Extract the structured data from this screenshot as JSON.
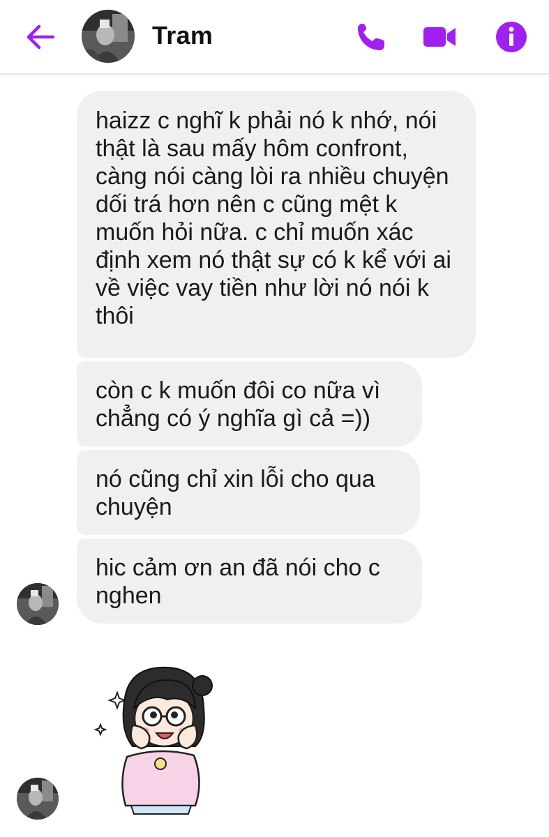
{
  "header": {
    "contact_name": "Tram",
    "icons": {
      "back": "back-arrow-icon",
      "call": "phone-icon",
      "video": "video-camera-icon",
      "info": "info-icon"
    },
    "accent_color": "#a020f0"
  },
  "messages": [
    {
      "text": "haizz c nghĩ k phải nó k nhớ, nói thật là sau mấy hôm confront, càng nói càng lòi ra nhiều chuyện dối trá hơn nên c cũng mệt k muốn hỏi nữa. c chỉ muốn xác định xem nó thật sự có k kể với ai về việc vay tiền như lời nó nói k thôi"
    },
    {
      "text": "còn c k muốn đôi co nữa vì chẳng có ý nghĩa gì cả =))"
    },
    {
      "text": "nó cũng chỉ xin lỗi cho qua chuyện"
    },
    {
      "text": "hic cảm ơn an đã nói cho c nghen"
    }
  ],
  "sticker": {
    "icon": "girl-blushing-sticker"
  },
  "colors": {
    "bubble_bg": "#f0f0f0",
    "text": "#1a1a1a"
  }
}
